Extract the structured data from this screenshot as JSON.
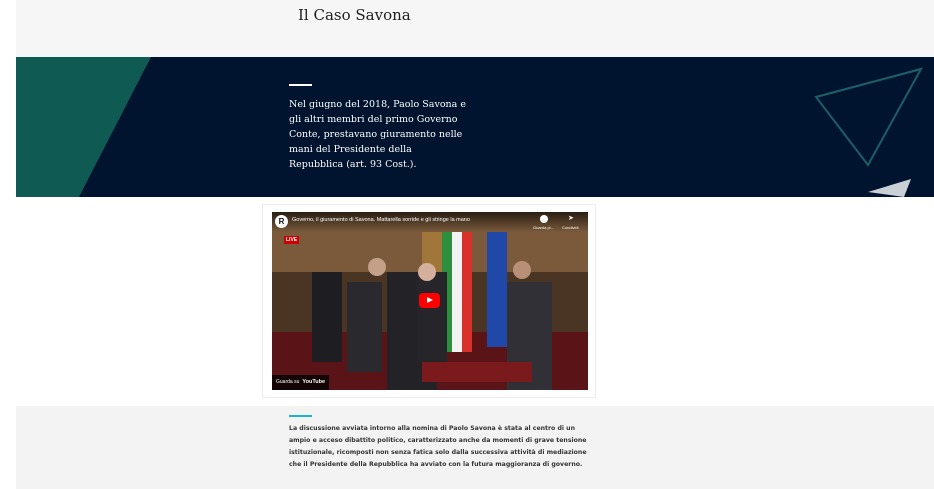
{
  "header": {
    "title": "Il Caso Savona"
  },
  "hero": {
    "text": "Nel giugno del 2018, Paolo Savona e gli altri membri del primo Governo Conte, prestavano giuramento nelle mani del Presidente della Repubblica (art. 93 Cost.).",
    "colors": {
      "background": "#01142f",
      "accent": "#0f5a52"
    }
  },
  "video": {
    "channel_badge": "R",
    "title": "Governo, il giuramento di Savona. Mattarella sorride e gli stringe la mano",
    "watch_later_label": "Guarda pi...",
    "share_label": "Condividi",
    "live_badge": "LIVE",
    "watch_on_label": "Guarda su",
    "platform_logo": "YouTube",
    "icons": [
      "channel-badge",
      "clock-icon",
      "share-icon",
      "play-button-icon"
    ]
  },
  "lower": {
    "text": "La discussione avviata intorno alla nomina di Paolo Savona è stata al centro di un ampio e acceso dibattito politico, caratterizzato anche da momenti di grave tensione istituzionale, ricomposti non senza fatica solo dalla successiva attività di mediazione che il Presidente della Repubblica ha avviato con la futura maggioranza di governo.",
    "accent": "#19b4c8"
  }
}
